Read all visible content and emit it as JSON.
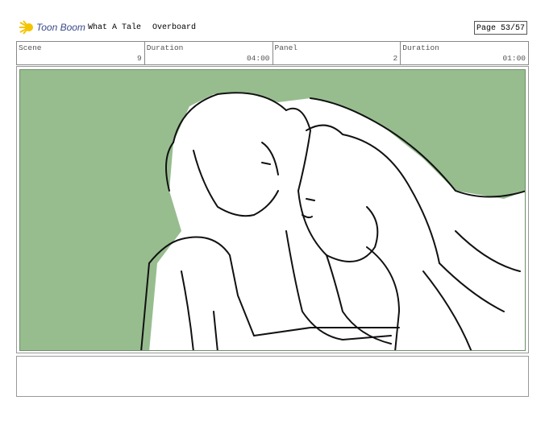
{
  "header": {
    "logo_text": "Toon Boom",
    "project_title": "What A Tale",
    "episode_title": "Overboard",
    "page_label": "Page 53/57"
  },
  "info": [
    {
      "label": "Scene",
      "value": "9"
    },
    {
      "label": "Duration",
      "value": "04:00"
    },
    {
      "label": "Panel",
      "value": "2"
    },
    {
      "label": "Duration",
      "value": "01:00"
    }
  ],
  "panel": {
    "background_color": "#97bd8f",
    "content": "sketch-drawing"
  },
  "caption": {
    "text": ""
  }
}
